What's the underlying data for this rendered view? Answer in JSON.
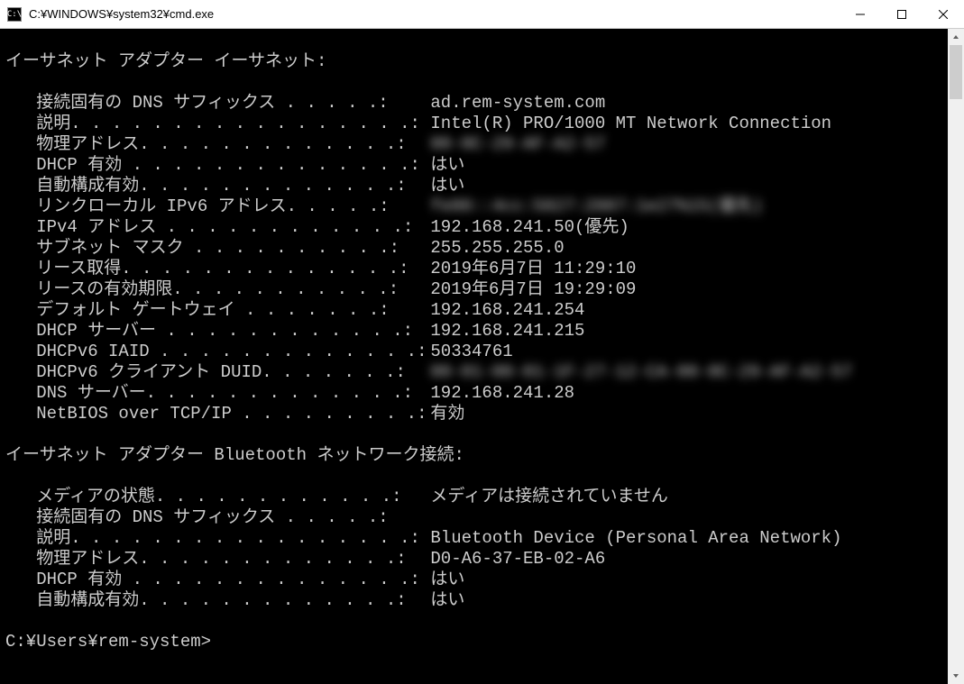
{
  "window": {
    "title": "C:¥WINDOWS¥system32¥cmd.exe",
    "icon_glyph": "C:\\"
  },
  "output": {
    "adapter1": {
      "header": "イーサネット アダプター イーサネット:",
      "rows": [
        {
          "label": "   接続固有の DNS サフィックス . . . . .:",
          "value": "ad.rem-system.com",
          "blur": false
        },
        {
          "label": "   説明. . . . . . . . . . . . . . . . .:",
          "value": "Intel(R) PRO/1000 MT Network Connection",
          "blur": false
        },
        {
          "label": "   物理アドレス. . . . . . . . . . . . .:",
          "value": "00-0C-29-AF-A2-57",
          "blur": true
        },
        {
          "label": "   DHCP 有効 . . . . . . . . . . . . . .:",
          "value": "はい",
          "blur": false
        },
        {
          "label": "   自動構成有効. . . . . . . . . . . . .:",
          "value": "はい",
          "blur": false
        },
        {
          "label": "   リンクローカル IPv6 アドレス. . . . .:",
          "value": "fe80::4cc:5827:2887:1e27%15(優先)",
          "blur": true
        },
        {
          "label": "   IPv4 アドレス . . . . . . . . . . . .:",
          "value": "192.168.241.50(優先)",
          "blur": false
        },
        {
          "label": "   サブネット マスク . . . . . . . . . .:",
          "value": "255.255.255.0",
          "blur": false
        },
        {
          "label": "   リース取得. . . . . . . . . . . . . .:",
          "value": "2019年6月7日 11:29:10",
          "blur": false
        },
        {
          "label": "   リースの有効期限. . . . . . . . . . .:",
          "value": "2019年6月7日 19:29:09",
          "blur": false
        },
        {
          "label": "   デフォルト ゲートウェイ . . . . . . .:",
          "value": "192.168.241.254",
          "blur": false
        },
        {
          "label": "   DHCP サーバー . . . . . . . . . . . .:",
          "value": "192.168.241.215",
          "blur": false
        },
        {
          "label": "   DHCPv6 IAID . . . . . . . . . . . . .:",
          "value": "50334761",
          "blur": false
        },
        {
          "label": "   DHCPv6 クライアント DUID. . . . . . .:",
          "value": "00-01-00-01-1F-27-12-CA-00-0C-29-AF-A2-57",
          "blur": true
        },
        {
          "label": "   DNS サーバー. . . . . . . . . . . . .:",
          "value": "192.168.241.28",
          "blur": false
        },
        {
          "label": "   NetBIOS over TCP/IP . . . . . . . . .:",
          "value": "有効",
          "blur": false
        }
      ]
    },
    "adapter2": {
      "header": "イーサネット アダプター Bluetooth ネットワーク接続:",
      "rows": [
        {
          "label": "   メディアの状態. . . . . . . . . . . .:",
          "value": "メディアは接続されていません",
          "blur": false
        },
        {
          "label": "   接続固有の DNS サフィックス . . . . .:",
          "value": "",
          "blur": false
        },
        {
          "label": "   説明. . . . . . . . . . . . . . . . .:",
          "value": "Bluetooth Device (Personal Area Network)",
          "blur": false
        },
        {
          "label": "   物理アドレス. . . . . . . . . . . . .:",
          "value": "D0-A6-37-EB-02-A6",
          "blur": false
        },
        {
          "label": "   DHCP 有効 . . . . . . . . . . . . . .:",
          "value": "はい",
          "blur": false
        },
        {
          "label": "   自動構成有効. . . . . . . . . . . . .:",
          "value": "はい",
          "blur": false
        }
      ]
    },
    "prompt": "C:¥Users¥rem-system>"
  }
}
